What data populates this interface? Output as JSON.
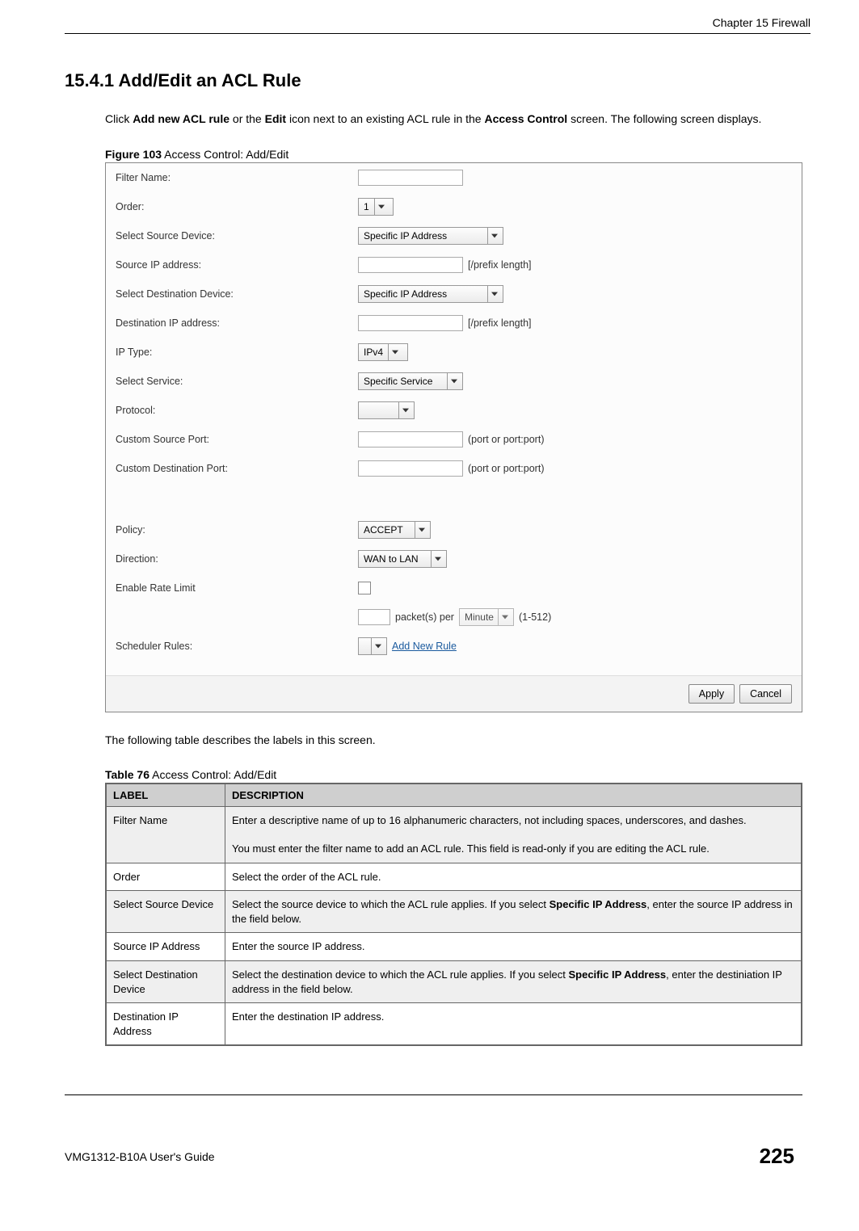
{
  "chapter_header": "Chapter 15 Firewall",
  "section_number": "15.4.1",
  "section_title_rest": "  Add/Edit an ACL Rule",
  "intro": {
    "pre": "Click ",
    "b1": "Add new ACL rule",
    "mid1": " or the ",
    "b2": "Edit",
    "mid2": " icon next to an existing ACL rule in the ",
    "b3": "Access Control",
    "post": " screen. The following screen displays."
  },
  "figure_caption_prefix": "Figure 103",
  "figure_caption_rest": "   Access Control: Add/Edit",
  "form": {
    "filter_name": "Filter Name:",
    "order": "Order:",
    "order_value": "1",
    "src_device": "Select Source Device:",
    "src_device_value": "Specific IP Address",
    "src_ip": "Source IP address:",
    "prefix_hint": "[/prefix length]",
    "dst_device": "Select Destination Device:",
    "dst_device_value": "Specific IP Address",
    "dst_ip": "Destination IP address:",
    "ip_type": "IP Type:",
    "ip_type_value": "IPv4",
    "service": "Select Service:",
    "service_value": "Specific Service",
    "protocol": "Protocol:",
    "protocol_value": "",
    "csp": "Custom Source Port:",
    "cdp": "Custom Destination Port:",
    "port_hint": "(port or port:port)",
    "policy": "Policy:",
    "policy_value": "ACCEPT",
    "direction": "Direction:",
    "direction_value": "WAN to LAN",
    "rate": "Enable Rate Limit",
    "rate_packet": "packet(s) per",
    "rate_unit": "Minute",
    "rate_range": "(1-512)",
    "scheduler": "Scheduler Rules:",
    "add_rule": "Add New Rule",
    "apply": "Apply",
    "cancel": "Cancel"
  },
  "table_intro": "The following table describes the labels in this screen.",
  "table_caption_prefix": "Table 76",
  "table_caption_rest": "   Access Control: Add/Edit",
  "table_headers": {
    "label": "LABEL",
    "desc": "DESCRIPTION"
  },
  "rows": [
    {
      "label": "Filter Name",
      "desc": "Enter a descriptive name of up to 16 alphanumeric characters, not including spaces, underscores, and dashes.\n\nYou must enter the filter name to add an ACL rule. This field is read-only if you are editing the ACL rule."
    },
    {
      "label": "Order",
      "desc": "Select the order of the ACL rule."
    },
    {
      "label": "Select Source Device",
      "desc_pre": "Select the source device to which the ACL rule applies. If you select ",
      "desc_bold": "Specific IP Address",
      "desc_post": ", enter the source IP address in the field below."
    },
    {
      "label": "Source IP Address",
      "desc": "Enter the source IP address."
    },
    {
      "label": "Select Destination Device",
      "desc_pre": "Select the destination device to which the ACL rule applies. If you select ",
      "desc_bold": "Specific IP Address",
      "desc_post": ", enter the destiniation IP address in the field below."
    },
    {
      "label": "Destination IP Address",
      "desc": "Enter the destination IP address."
    }
  ],
  "footer_left": "VMG1312-B10A User's Guide",
  "footer_right": "225"
}
